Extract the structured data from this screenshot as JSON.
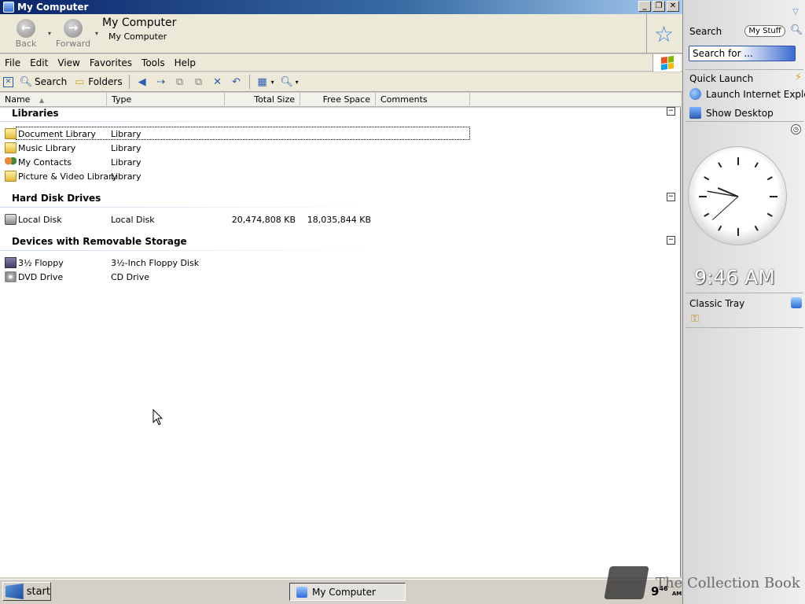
{
  "window": {
    "title": "My Computer",
    "controls": {
      "minimize": "_",
      "restore": "❐",
      "close": "✕"
    }
  },
  "nav": {
    "back_label": "Back",
    "forward_label": "Forward",
    "location_title": "My Computer",
    "location_sub": "My Computer"
  },
  "menu": {
    "items": [
      {
        "label": "File"
      },
      {
        "label": "Edit"
      },
      {
        "label": "View"
      },
      {
        "label": "Favorites"
      },
      {
        "label": "Tools"
      },
      {
        "label": "Help"
      }
    ]
  },
  "toolbar": {
    "search_label": "Search",
    "folders_label": "Folders"
  },
  "columns": {
    "name": "Name",
    "type": "Type",
    "total_size": "Total Size",
    "free_space": "Free Space",
    "comments": "Comments"
  },
  "groups": {
    "libraries": {
      "title": "Libraries",
      "items": [
        {
          "name": "Document Library",
          "type": "Library"
        },
        {
          "name": "Music Library",
          "type": "Library"
        },
        {
          "name": "My Contacts",
          "type": "Library"
        },
        {
          "name": "Picture & Video Library",
          "type": "Library"
        }
      ]
    },
    "hard_disks": {
      "title": "Hard Disk Drives",
      "items": [
        {
          "name": "Local Disk",
          "type": "Local Disk",
          "total": "20,474,808 KB",
          "free": "18,035,844 KB"
        }
      ]
    },
    "removable": {
      "title": "Devices with Removable Storage",
      "items": [
        {
          "name": "3½ Floppy",
          "type": "3½-Inch Floppy Disk"
        },
        {
          "name": "DVD Drive",
          "type": "CD Drive"
        }
      ]
    }
  },
  "sidebar": {
    "search_label": "Search",
    "mystuff_label": "My Stuff",
    "search_placeholder": "Search for ...",
    "quick_launch_title": "Quick Launch",
    "quick_launch": [
      {
        "label": "Launch Internet Explore"
      },
      {
        "label": "Show Desktop"
      }
    ],
    "time": "9:46 AM",
    "clock": {
      "hour": 9,
      "minute": 46,
      "second": 38
    },
    "classic_tray_title": "Classic Tray"
  },
  "taskbar": {
    "start_label": "start",
    "task_label": "My Computer",
    "tray_hour": "9",
    "tray_minute": "46",
    "tray_ampm": "AM"
  },
  "watermark": "The Collection Book"
}
